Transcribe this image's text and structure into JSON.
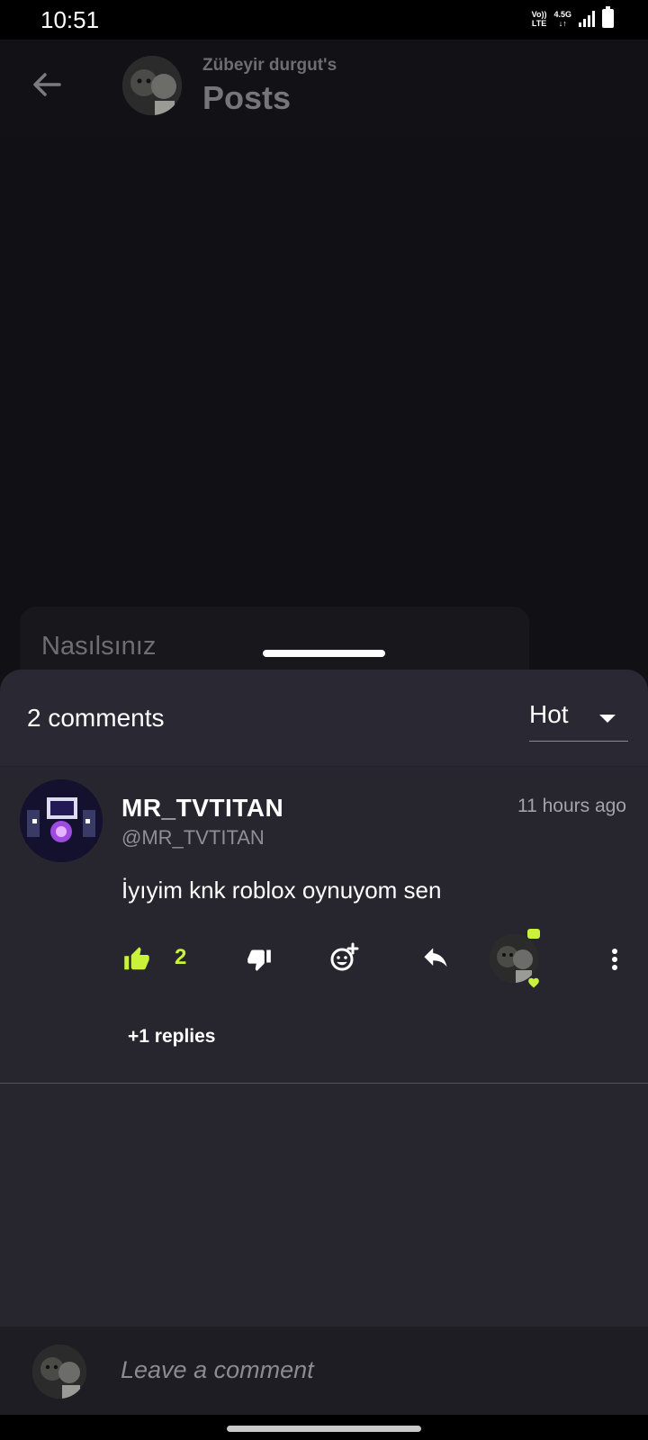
{
  "status_bar": {
    "time": "10:51",
    "network_top": "Vo))",
    "network_bottom": "LTE",
    "data_top": "4.5G",
    "data_bottom": "↓↑"
  },
  "header": {
    "subtitle": "Zübeyir durgut's",
    "title": "Posts",
    "back_icon": "arrow-left-icon"
  },
  "post": {
    "text": "Nasılsınız"
  },
  "comments_sheet": {
    "count_label": "2 comments",
    "sort_value": "Hot",
    "comments": [
      {
        "author": "MR_TVTITAN",
        "handle": "@MR_TVTITAN",
        "time": "11 hours ago",
        "body": "İyıyim knk roblox oynuyom sen",
        "like_count": "2",
        "replies_label": "+1 replies"
      }
    ]
  },
  "composer": {
    "placeholder": "Leave a comment"
  },
  "colors": {
    "accent": "#c9f23b",
    "sheet": "#27262f",
    "backdrop": "#101015"
  }
}
